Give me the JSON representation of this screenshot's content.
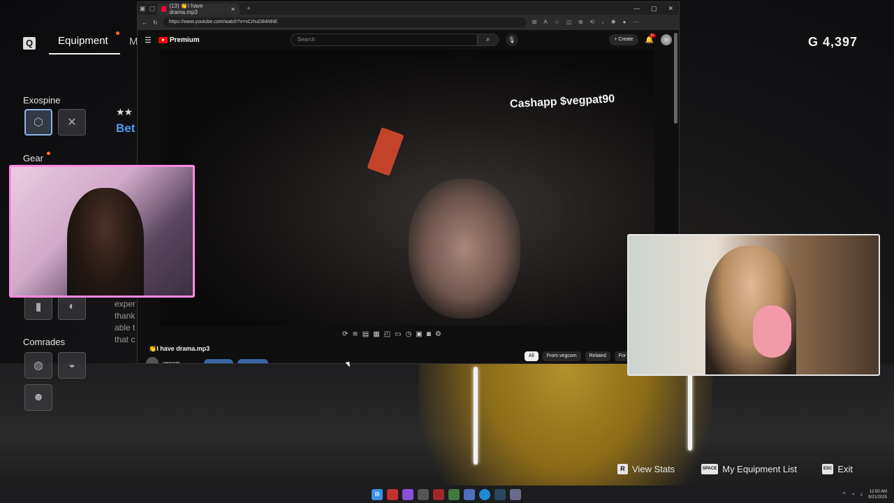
{
  "game": {
    "key_q": "Q",
    "tab_equipment": "Equipment",
    "tab_next_partial": "M",
    "money": "G 4,397",
    "section_exospine": "Exospine",
    "section_gear": "Gear",
    "section_comrades": "Comrades",
    "stars": "★★",
    "item_title_partial": "Bet",
    "desc_lines": [
      "exper",
      "thank",
      "able t",
      "that c"
    ],
    "actions": [
      {
        "key": "R",
        "label": "View Stats"
      },
      {
        "key": "SPACE",
        "label": "My Equipment List"
      },
      {
        "key": "ESC",
        "label": "Exit"
      }
    ]
  },
  "browser": {
    "tab_title": "(13) 👏I have drama.mp3",
    "url": "https://www.youtube.com/watch?v=xCrhuD84NNE",
    "youtube": {
      "logo": "Premium",
      "search_placeholder": "Search",
      "create_label": "Create",
      "notification_badge": "9+",
      "video_caption": "Cashapp $vegpat90",
      "video_title": "👏I have drama.mp3",
      "channel_name": "vegcom",
      "chips": [
        "All",
        "From vegcom",
        "Related",
        "For yo"
      ]
    }
  },
  "taskbar": {
    "time": "12:50 AM",
    "date": "9/21/2025"
  },
  "colors": {
    "webcam1_border": "#ff8ce0",
    "youtube_red": "#ff0000",
    "accent_blue": "#4d9cf0",
    "notification_dot": "#ff6a2b"
  },
  "icons": [
    "hamburger-icon",
    "search-icon",
    "mic-icon",
    "bell-icon",
    "refresh-icon",
    "back-icon",
    "play-logo-icon"
  ]
}
